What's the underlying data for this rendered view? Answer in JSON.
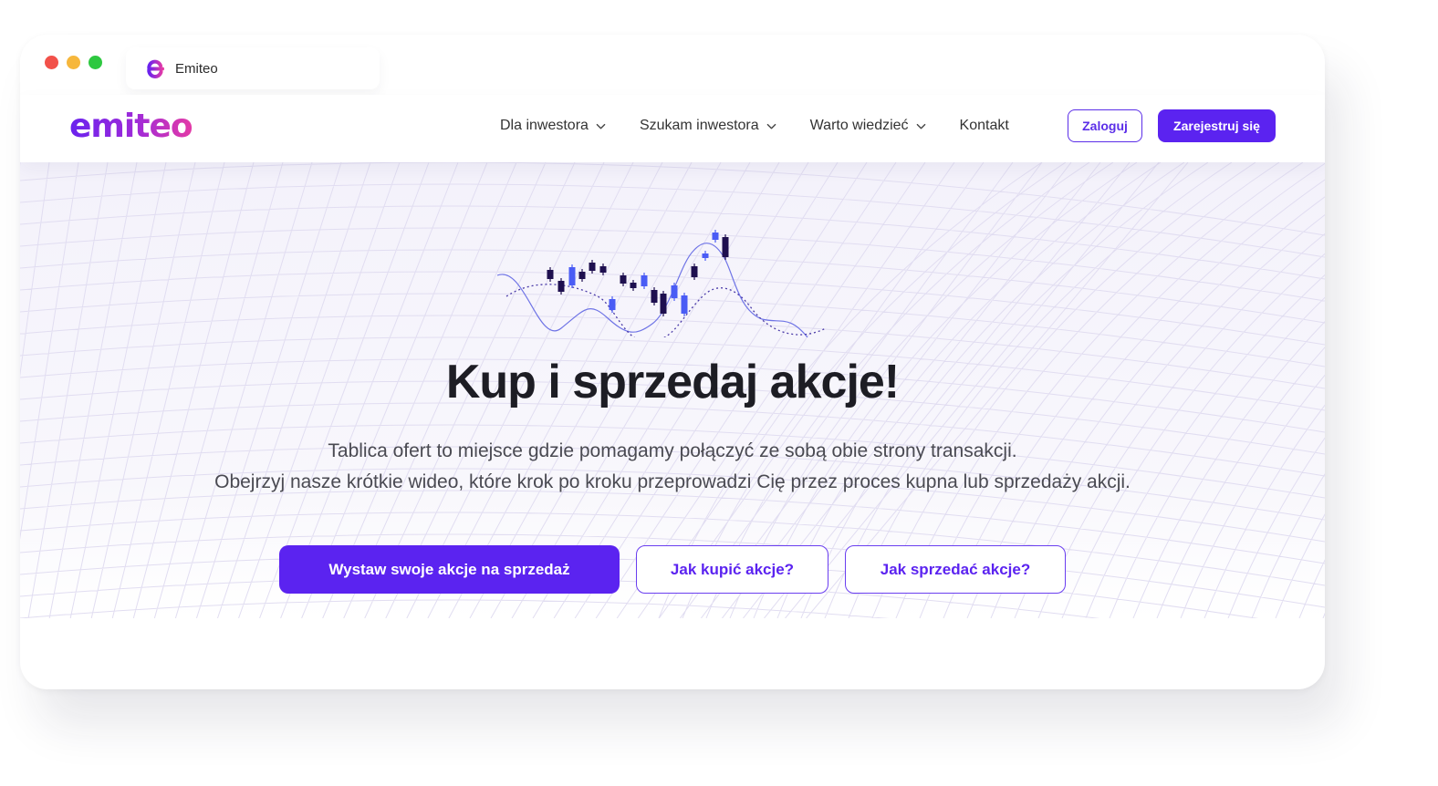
{
  "browser": {
    "window_dots": [
      "#f2514a",
      "#f6b73c",
      "#2ec840"
    ],
    "tab_title": "Emiteo"
  },
  "header": {
    "logo_text": "emiteo",
    "nav": [
      {
        "label": "Dla inwestora",
        "has_dropdown": true
      },
      {
        "label": "Szukam inwestora",
        "has_dropdown": true
      },
      {
        "label": "Warto wiedzieć",
        "has_dropdown": true
      },
      {
        "label": "Kontakt",
        "has_dropdown": false
      }
    ],
    "login_label": "Zaloguj",
    "register_label": "Zarejestruj się"
  },
  "hero": {
    "title": "Kup i sprzedaj akcje!",
    "description_line1": "Tablica ofert to miejsce gdzie pomagamy połączyć ze sobą obie strony transakcji.",
    "description_line2": "Obejrzyj nasze krótkie wideo, które krok po kroku przeprowadzi Cię przez proces kupna lub sprzedaży akcji.",
    "cta_primary": "Wystaw swoje akcje na sprzedaż",
    "cta_buy": "Jak kupić akcje?",
    "cta_sell": "Jak sprzedać akcje?"
  },
  "colors": {
    "accent": "#5b23f0",
    "candle_dark": "#1e0f4f",
    "candle_blue": "#4a5cf5"
  }
}
